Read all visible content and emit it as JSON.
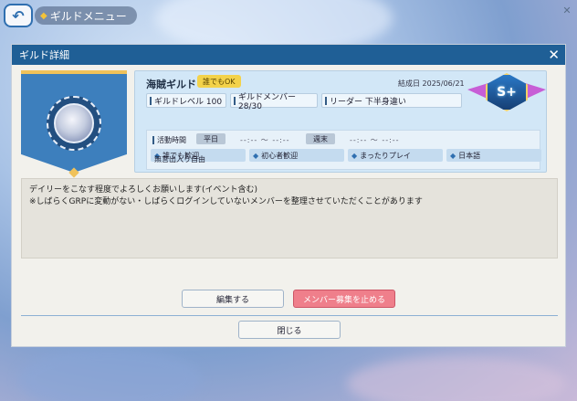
{
  "header": {
    "back_icon": "back-arrow-icon",
    "menu_title": "ギルドメニュー"
  },
  "dialog": {
    "title": "ギルド詳細",
    "close_icon": "close-icon"
  },
  "guild": {
    "name": "海賊ギルド",
    "join_badge": "誰でもOK",
    "founded": "結成日 2025/06/21",
    "rank": "S+",
    "level": "ギルドレベル 100",
    "members": "ギルドメンバー 28/30",
    "leader": "リーダー 下半身違い",
    "activity_label": "活動時間",
    "weekday_label": "平日",
    "weekday_time": "--:-- ～ --:--",
    "weekend_label": "週末",
    "weekend_time": "--:-- ～ --:--",
    "tags": [
      "誰でも歓迎",
      "初心者歓迎",
      "まったりプレイ",
      "日本語"
    ],
    "policy": "無言出入り自由",
    "description_line1": "デイリーをこなす程度でよろしくお願いします(イベント含む)",
    "description_line2": "※しばらくGRPに変動がない・しばらくログインしていないメンバーを整理させていただくことがあります"
  },
  "buttons": {
    "edit": "編集する",
    "stop_recruit": "メンバー募集を止める",
    "close": "閉じる"
  },
  "colors": {
    "header_blue": "#1f5f96",
    "info_panel": "#d2e7f7",
    "stop_button": "#ef7f8b",
    "badge_yellow": "#f3d24a"
  }
}
